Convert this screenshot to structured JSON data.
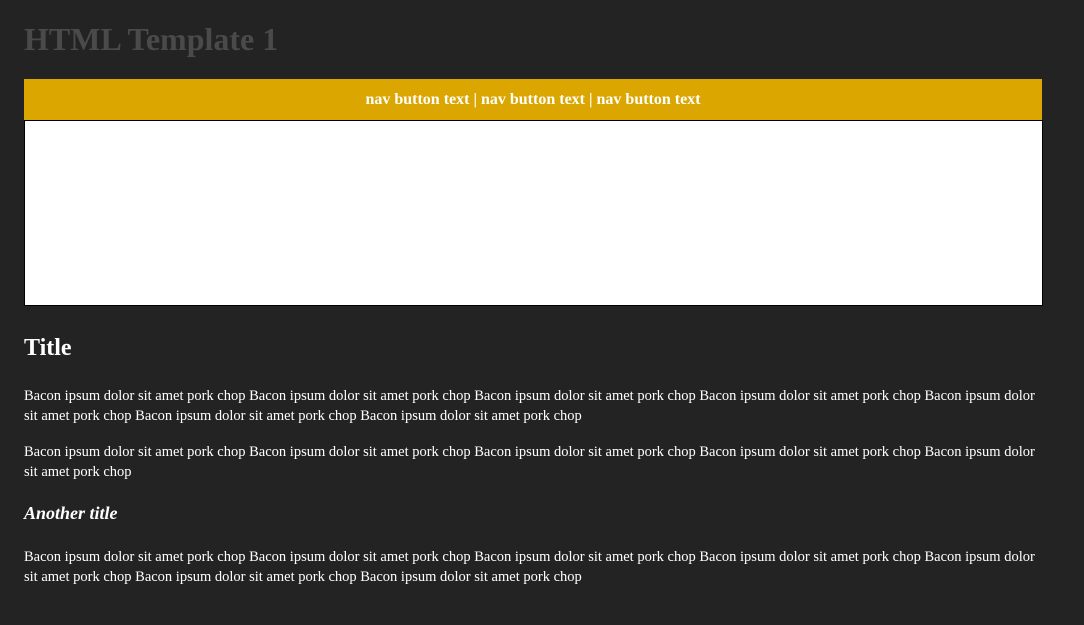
{
  "page": {
    "heading": "HTML Template 1"
  },
  "nav": {
    "items": [
      "nav button text",
      "nav button text",
      "nav button text"
    ],
    "separator": "|",
    "bg_color": "#dba600"
  },
  "content": {
    "title": "Title",
    "paragraph1": "Bacon ipsum dolor sit amet pork chop Bacon ipsum dolor sit amet pork chop Bacon ipsum dolor sit amet pork chop Bacon ipsum dolor sit amet pork chop Bacon ipsum dolor sit amet pork chop Bacon ipsum dolor sit amet pork chop Bacon ipsum dolor sit amet pork chop",
    "paragraph2": "Bacon ipsum dolor sit amet pork chop Bacon ipsum dolor sit amet pork chop Bacon ipsum dolor sit amet pork chop Bacon ipsum dolor sit amet pork chop Bacon ipsum dolor sit amet pork chop",
    "subtitle": "Another title",
    "paragraph3": "Bacon ipsum dolor sit amet pork chop Bacon ipsum dolor sit amet pork chop Bacon ipsum dolor sit amet pork chop Bacon ipsum dolor sit amet pork chop Bacon ipsum dolor sit amet pork chop Bacon ipsum dolor sit amet pork chop Bacon ipsum dolor sit amet pork chop"
  }
}
